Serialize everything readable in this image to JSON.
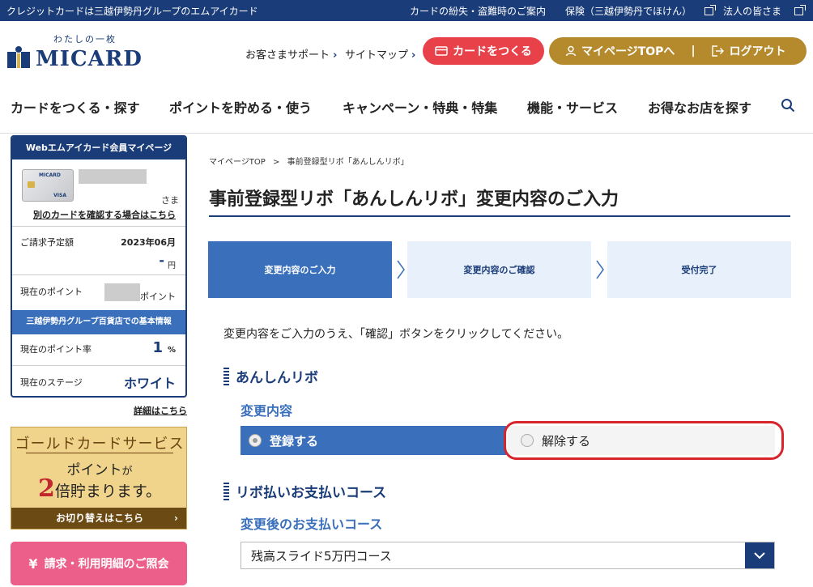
{
  "topbar": {
    "left_text": "クレジットカードは三越伊勢丹グループのエムアイカード",
    "links": [
      "カードの紛失・盗難時のご案内",
      "保険（三越伊勢丹でほけん）",
      "法人の皆さま"
    ]
  },
  "header": {
    "logo_tagline": "わたしの一枚",
    "logo_word": "MICARD",
    "support_link": "お客さまサポート",
    "sitemap_link": "サイトマップ",
    "card_button": "カードをつくる",
    "mypage_button": "マイページTOPへ",
    "logout_button": "ログアウト"
  },
  "nav": {
    "items": [
      "カードをつくる・探す",
      "ポイントを貯める・使う",
      "キャンペーン・特典・特集",
      "機能・サービス",
      "お得なお店を探す"
    ]
  },
  "sidebar": {
    "member_title": "Webエムアイカード会員マイページ",
    "card_brand": "MICARD",
    "card_network": "VISA",
    "sama": "さま",
    "other_card_link": "別のカードを確認する場合はこちら",
    "billing_label": "ご請求予定額",
    "billing_month": "2023年06月",
    "billing_amount": "-",
    "billing_unit": "円",
    "points_label": "現在のポイント",
    "points_unit": "ポイント",
    "group_info": "三越伊勢丹グループ百貨店での基本情報",
    "rate_label": "現在のポイント率",
    "rate_value": "1",
    "rate_unit": "%",
    "stage_label": "現在のステージ",
    "stage_value": "ホワイト",
    "detail_link": "詳細はこちら",
    "gold_title": "ゴールドカードサービス",
    "gold_line2_a": "ポイント",
    "gold_line2_b": "が",
    "gold_line3_a": "2",
    "gold_line3_b": "倍貯まります。",
    "gold_footer": "お切り替えはこちら",
    "billing_button": "請求・利用明細のご照会"
  },
  "main": {
    "breadcrumb": [
      "マイページTOP",
      "事前登録型リボ「あんしんリボ」"
    ],
    "title": "事前登録型リボ「あんしんリボ」変更内容のご入力",
    "steps": [
      {
        "label": "変更内容のご入力",
        "active": true
      },
      {
        "label": "変更内容のご確認",
        "active": false
      },
      {
        "label": "受付完了",
        "active": false
      }
    ],
    "instruction": "変更内容をご入力のうえ、「確認」ボタンをクリックしてください。",
    "section1_title": "あんしんリボ",
    "section1_sub": "変更内容",
    "option_register": "登録する",
    "option_cancel": "解除する",
    "section2_title": "リボ払いお支払いコース",
    "section2_sub": "変更後のお支払いコース",
    "selected_course": "残高スライド5万円コース"
  },
  "colors": {
    "navy": "#1a3c78",
    "accent_blue": "#3a6fbb",
    "card_red": "#e8414a",
    "mypage_gold": "#b58a2c",
    "highlight_red": "#d8242b",
    "pink": "#ec5f8a"
  }
}
